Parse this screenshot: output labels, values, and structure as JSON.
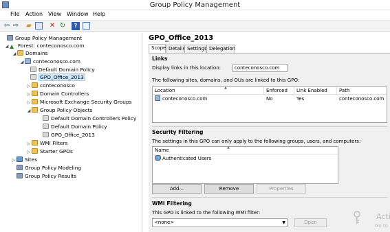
{
  "window": {
    "title": "Group Policy Management"
  },
  "menu": [
    "File",
    "Action",
    "View",
    "Window",
    "Help"
  ],
  "toolbar_icons": [
    "back-icon",
    "forward-icon",
    "up-folder-icon",
    "console-tree-icon",
    "delete-icon",
    "refresh-icon",
    "help-icon",
    "properties-icon"
  ],
  "tree": {
    "root": "Group Policy Management",
    "forest": "Forest: conteconosco.com",
    "domains": "Domains",
    "domain": "conteconosco.com",
    "default_domain_policy": "Default Domain Policy",
    "gpo_office": "GPO_Office_2013",
    "conteconosco_ou": "conteconosco",
    "domain_controllers": "Domain Controllers",
    "mes_groups": "Microsoft Exchange Security Groups",
    "gpo_objects": "Group Policy Objects",
    "obj_ddcp": "Default Domain Controllers Policy",
    "obj_ddp": "Default Domain Policy",
    "obj_gpo": "GPO_Office_2013",
    "wmi_filters": "WMI Filters",
    "starter_gpos": "Starter GPOs",
    "sites": "Sites",
    "modeling": "Group Policy Modeling",
    "results": "Group Policy Results"
  },
  "gpo": {
    "title": "GPO_Office_2013",
    "tabs": [
      "Scope",
      "Details",
      "Settings",
      "Delegation"
    ],
    "links": {
      "heading": "Links",
      "display_label": "Display links in this location:",
      "display_value": "conteconosco.com",
      "linked_text": "The following sites, domains, and OUs are linked to this GPO:",
      "columns": [
        "Location",
        "Enforced",
        "Link Enabled",
        "Path"
      ],
      "rows": [
        {
          "location": "conteconosco.com",
          "enforced": "No",
          "link_enabled": "Yes",
          "path": "conteconosco.com"
        }
      ]
    },
    "security": {
      "heading": "Security Filtering",
      "text": "The settings in this GPO can only apply to the following groups, users, and computers:",
      "column": "Name",
      "rows": [
        "Authenticated Users"
      ],
      "buttons": {
        "add": "Add...",
        "remove": "Remove",
        "properties": "Properties"
      }
    },
    "wmi": {
      "heading": "WMI Filtering",
      "text": "This GPO is linked to the following WMI filter:",
      "value": "<none>",
      "open": "Open"
    }
  },
  "watermark": {
    "line1": "Acti",
    "line2": "Go to"
  }
}
